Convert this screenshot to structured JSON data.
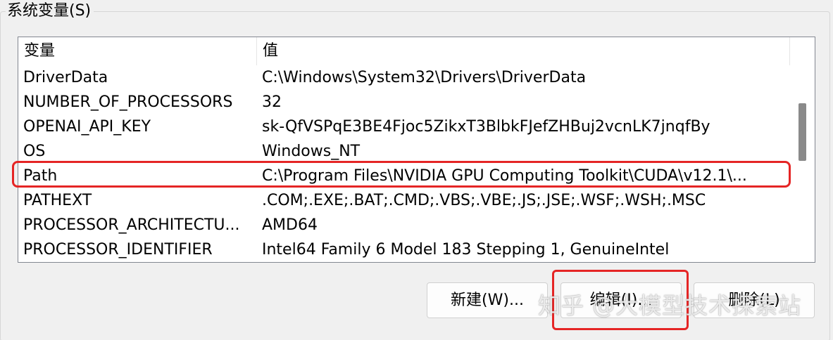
{
  "groupbox": {
    "title": "系统变量(S)"
  },
  "list": {
    "columns": {
      "variable": "变量",
      "value": "值"
    },
    "rows": [
      {
        "variable": "DriverData",
        "value": "C:\\Windows\\System32\\Drivers\\DriverData"
      },
      {
        "variable": "NUMBER_OF_PROCESSORS",
        "value": "32"
      },
      {
        "variable": "OPENAI_API_KEY",
        "value": "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"
      },
      {
        "variable": "OS",
        "value": "Windows_NT"
      },
      {
        "variable": "Path",
        "value": "C:\\Program Files\\NVIDIA GPU Computing Toolkit\\CUDA\\v12.1\\..."
      },
      {
        "variable": "PATHEXT",
        "value": ".COM;.EXE;.BAT;.CMD;.VBS;.VBE;.JS;.JSE;.WSF;.WSH;.MSC"
      },
      {
        "variable": "PROCESSOR_ARCHITECTU...",
        "value": "AMD64"
      },
      {
        "variable": "PROCESSOR_IDENTIFIER",
        "value": "Intel64 Family 6 Model 183 Stepping 1, GenuineIntel"
      }
    ],
    "highlighted_row": "Path"
  },
  "buttons": {
    "new_label": "新建(W)...",
    "edit_label": "编辑(I)...",
    "delete_label": "删除(L)"
  },
  "watermark": {
    "text": "知乎 @大模型技术探索站"
  },
  "colors": {
    "highlight": "#e52525",
    "background": "#f0f0f0",
    "list_background": "#ffffff"
  }
}
